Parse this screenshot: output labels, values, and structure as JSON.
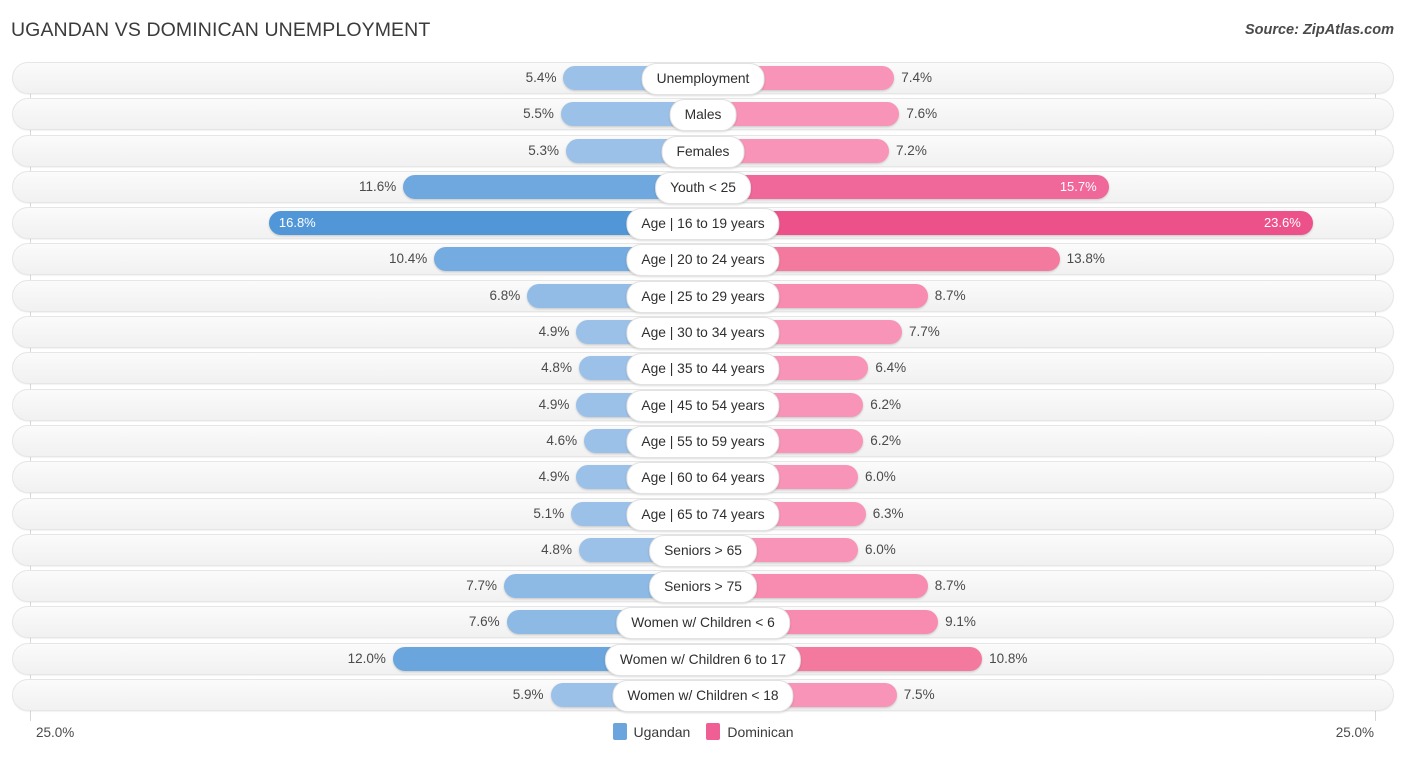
{
  "header": {
    "title": "UGANDAN VS DOMINICAN UNEMPLOYMENT",
    "source": "Source: ZipAtlas.com"
  },
  "axis": {
    "left_label": "25.0%",
    "right_label": "25.0%",
    "max": 25.0
  },
  "legend": [
    {
      "label": "Ugandan",
      "color": "#6aa6dd"
    },
    {
      "label": "Dominican",
      "color": "#ef5f93"
    }
  ],
  "colors": {
    "left_light": "#9cc1e8",
    "left_mid": "#7fb0e2",
    "left_dark": "#5f9fdb",
    "left_darkest": "#4a93d6",
    "right_light": "#f894b7",
    "right_mid": "#f47ba6",
    "right_dark": "#f0679a",
    "right_darkest": "#ec4f88"
  },
  "chart_data": {
    "type": "bar",
    "title": "UGANDAN VS DOMINICAN UNEMPLOYMENT",
    "subtitle": "",
    "orientation": "horizontal-diverging",
    "xlabel": "",
    "ylabel": "",
    "xlim": [
      -25.0,
      25.0
    ],
    "grid": false,
    "legend_position": "bottom-center",
    "categories": [
      "Unemployment",
      "Males",
      "Females",
      "Youth < 25",
      "Age | 16 to 19 years",
      "Age | 20 to 24 years",
      "Age | 25 to 29 years",
      "Age | 30 to 34 years",
      "Age | 35 to 44 years",
      "Age | 45 to 54 years",
      "Age | 55 to 59 years",
      "Age | 60 to 64 years",
      "Age | 65 to 74 years",
      "Seniors > 65",
      "Seniors > 75",
      "Women w/ Children < 6",
      "Women w/ Children 6 to 17",
      "Women w/ Children < 18"
    ],
    "series": [
      {
        "name": "Ugandan",
        "values": [
          5.4,
          5.5,
          5.3,
          11.6,
          16.8,
          10.4,
          6.8,
          4.9,
          4.8,
          4.9,
          4.6,
          4.9,
          5.1,
          4.8,
          7.7,
          7.6,
          12.0,
          5.9
        ]
      },
      {
        "name": "Dominican",
        "values": [
          7.4,
          7.6,
          7.2,
          15.7,
          23.6,
          13.8,
          8.7,
          7.7,
          6.4,
          6.2,
          6.2,
          6.0,
          6.3,
          6.0,
          8.7,
          9.1,
          10.8,
          7.5
        ]
      }
    ]
  },
  "rows": [
    {
      "label": "Unemployment",
      "left": "5.4%",
      "right": "7.4%",
      "lv": 5.4,
      "rv": 7.4,
      "lc": "#9cc1e8",
      "rc": "#f894b7",
      "l_inside": false,
      "r_inside": false
    },
    {
      "label": "Males",
      "left": "5.5%",
      "right": "7.6%",
      "lv": 5.5,
      "rv": 7.6,
      "lc": "#9cc1e8",
      "rc": "#f894b7",
      "l_inside": false,
      "r_inside": false
    },
    {
      "label": "Females",
      "left": "5.3%",
      "right": "7.2%",
      "lv": 5.3,
      "rv": 7.2,
      "lc": "#9cc1e8",
      "rc": "#f894b7",
      "l_inside": false,
      "r_inside": false
    },
    {
      "label": "Youth < 25",
      "left": "11.6%",
      "right": "15.7%",
      "lv": 11.6,
      "rv": 15.7,
      "lc": "#6fa8df",
      "rc": "#f0679a",
      "l_inside": false,
      "r_inside": true
    },
    {
      "label": "Age | 16 to 19 years",
      "left": "16.8%",
      "right": "23.6%",
      "lv": 16.8,
      "rv": 23.6,
      "lc": "#5197d8",
      "rc": "#ec5189",
      "l_inside": true,
      "r_inside": true
    },
    {
      "label": "Age | 20 to 24 years",
      "left": "10.4%",
      "right": "13.8%",
      "lv": 10.4,
      "rv": 13.8,
      "lc": "#74abe0",
      "rc": "#f4799f",
      "l_inside": false,
      "r_inside": false
    },
    {
      "label": "Age | 25 to 29 years",
      "left": "6.8%",
      "right": "8.7%",
      "lv": 6.8,
      "rv": 8.7,
      "lc": "#92bce6",
      "rc": "#f78bb0",
      "l_inside": false,
      "r_inside": false
    },
    {
      "label": "Age | 30 to 34 years",
      "left": "4.9%",
      "right": "7.7%",
      "lv": 4.9,
      "rv": 7.7,
      "lc": "#9cc1e8",
      "rc": "#f894b7",
      "l_inside": false,
      "r_inside": false
    },
    {
      "label": "Age | 35 to 44 years",
      "left": "4.8%",
      "right": "6.4%",
      "lv": 4.8,
      "rv": 6.4,
      "lc": "#9cc1e8",
      "rc": "#f894b7",
      "l_inside": false,
      "r_inside": false
    },
    {
      "label": "Age | 45 to 54 years",
      "left": "4.9%",
      "right": "6.2%",
      "lv": 4.9,
      "rv": 6.2,
      "lc": "#9cc1e8",
      "rc": "#f894b7",
      "l_inside": false,
      "r_inside": false
    },
    {
      "label": "Age | 55 to 59 years",
      "left": "4.6%",
      "right": "6.2%",
      "lv": 4.6,
      "rv": 6.2,
      "lc": "#9cc1e8",
      "rc": "#f894b7",
      "l_inside": false,
      "r_inside": false
    },
    {
      "label": "Age | 60 to 64 years",
      "left": "4.9%",
      "right": "6.0%",
      "lv": 4.9,
      "rv": 6.0,
      "lc": "#9cc1e8",
      "rc": "#f894b7",
      "l_inside": false,
      "r_inside": false
    },
    {
      "label": "Age | 65 to 74 years",
      "left": "5.1%",
      "right": "6.3%",
      "lv": 5.1,
      "rv": 6.3,
      "lc": "#9cc1e8",
      "rc": "#f894b7",
      "l_inside": false,
      "r_inside": false
    },
    {
      "label": "Seniors > 65",
      "left": "4.8%",
      "right": "6.0%",
      "lv": 4.8,
      "rv": 6.0,
      "lc": "#9cc1e8",
      "rc": "#f894b7",
      "l_inside": false,
      "r_inside": false
    },
    {
      "label": "Seniors > 75",
      "left": "7.7%",
      "right": "8.7%",
      "lv": 7.7,
      "rv": 8.7,
      "lc": "#8db9e5",
      "rc": "#f78bb0",
      "l_inside": false,
      "r_inside": false
    },
    {
      "label": "Women w/ Children < 6",
      "left": "7.6%",
      "right": "9.1%",
      "lv": 7.6,
      "rv": 9.1,
      "lc": "#8db9e5",
      "rc": "#f78bb0",
      "l_inside": false,
      "r_inside": false
    },
    {
      "label": "Women w/ Children 6 to 17",
      "left": "12.0%",
      "right": "10.8%",
      "lv": 12.0,
      "rv": 10.8,
      "lc": "#6aa6dd",
      "rc": "#f4799f",
      "l_inside": false,
      "r_inside": false
    },
    {
      "label": "Women w/ Children < 18",
      "left": "5.9%",
      "right": "7.5%",
      "lv": 5.9,
      "rv": 7.5,
      "lc": "#9cc1e8",
      "rc": "#f894b7",
      "l_inside": false,
      "r_inside": false
    }
  ]
}
